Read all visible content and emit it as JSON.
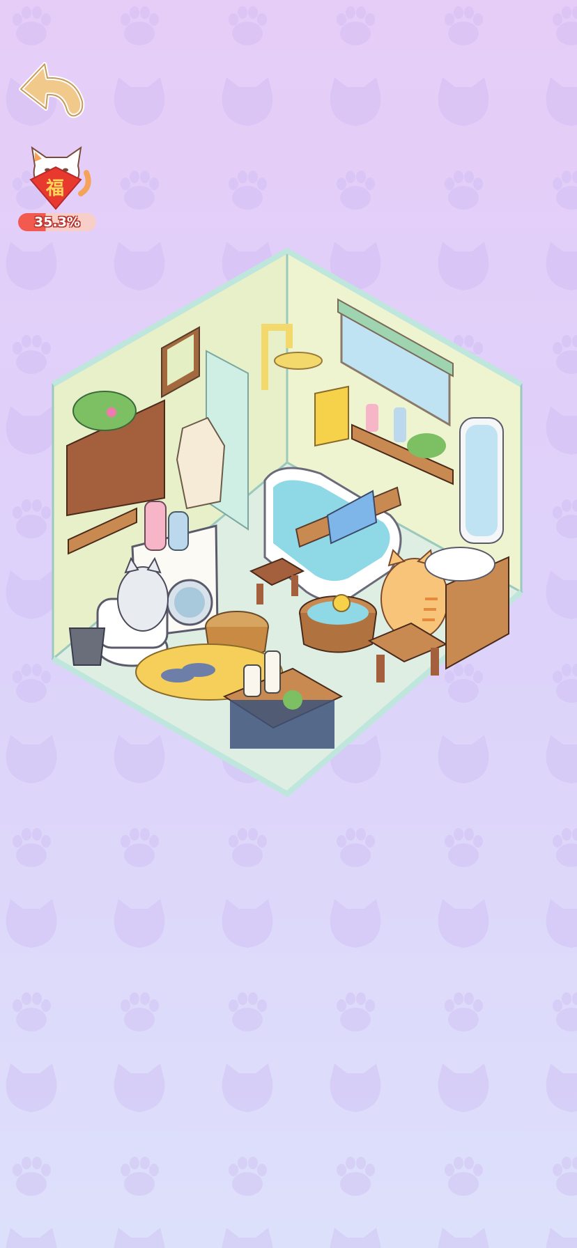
{
  "game": {
    "luck_badge": {
      "character": "福",
      "progress_text": "35.3%",
      "progress_fraction": 0.353
    }
  },
  "colors": {
    "background_top": "#e6cdf8",
    "background_bottom": "#dde0fb",
    "back_button": "#f1c98b",
    "badge_red": "#f25a4f",
    "wall": "#e7f0c8",
    "floor_tile": "#dfeee3",
    "glass_edge": "#bfe6dc"
  },
  "icons": {
    "back": "curved-arrow-icon",
    "badge": "lucky-cat-icon"
  }
}
